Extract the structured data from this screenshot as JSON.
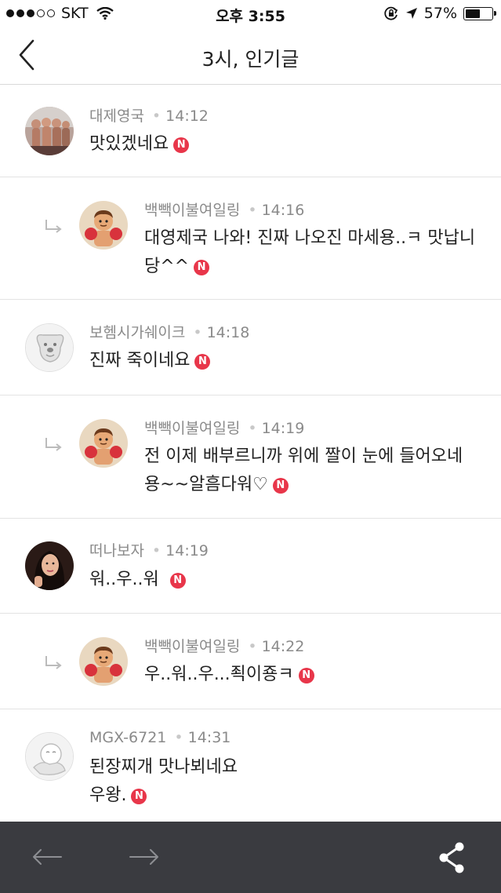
{
  "status_bar": {
    "carrier": "SKT",
    "time": "오후 3:55",
    "battery_percent": "57%",
    "battery_level": 0.57
  },
  "nav": {
    "title": "3시, 인기글",
    "back_icon": "chevron-left-icon"
  },
  "comments": [
    {
      "author": "대제영국",
      "time": "14:12",
      "lines": [
        "맛있겠네요"
      ],
      "badge": "N",
      "reply": false
    },
    {
      "author": "백빽이불여일링",
      "time": "14:16",
      "lines": [
        "대영제국 나와! 진짜 나오진 마세용..ㅋ 맛납니",
        "당^^"
      ],
      "badge": "N",
      "reply": true
    },
    {
      "author": "보헴시가쉐이크",
      "time": "14:18",
      "lines": [
        "진짜 죽이네요"
      ],
      "badge": "N",
      "reply": false
    },
    {
      "author": "백빽이불여일링",
      "time": "14:19",
      "lines": [
        "전 이제 배부르니까 위에 짤이 눈에 들어오네",
        "용~~알흠다워♡"
      ],
      "badge": "N",
      "reply": true
    },
    {
      "author": "떠나보자",
      "time": "14:19",
      "lines": [
        "워..우..워"
      ],
      "badge": "N",
      "reply": false
    },
    {
      "author": "백빽이불여일링",
      "time": "14:22",
      "lines": [
        "우..워..우...죅이죵ㅋ"
      ],
      "badge": "N",
      "reply": true
    },
    {
      "author": "MGX-6721",
      "time": "14:31",
      "lines": [
        "된장찌개 맛나뵈네요",
        "우왕."
      ],
      "badge": "N",
      "reply": false
    }
  ],
  "bottom_bar": {
    "back_icon": "arrow-left-icon",
    "forward_icon": "arrow-right-icon",
    "share_icon": "share-icon"
  },
  "colors": {
    "badge": "#e8364a",
    "bottom_bar": "#3a3b40",
    "meta_text": "#8a8a8a"
  }
}
